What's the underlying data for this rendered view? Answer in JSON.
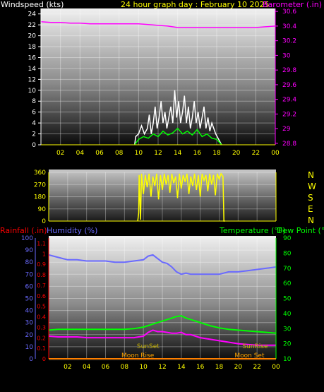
{
  "header": {
    "left_label": "Windspeed (kts)",
    "center_label": "24 hour graph day : February 10 2025",
    "right_label": "Barometer (.in)"
  },
  "colors": {
    "white": "#ffffff",
    "yellow": "#ffff00",
    "magenta": "#ff00ff",
    "green": "#00ff00",
    "red": "#ff0000",
    "blue": "#6a6aff",
    "orange": "#ffa500",
    "ochre": "#c8b400"
  },
  "chart_data": [
    {
      "type": "line",
      "panel": "wind-barometer",
      "x_ticks": [
        "02",
        "04",
        "06",
        "08",
        "10",
        "12",
        "14",
        "16",
        "18",
        "20",
        "22",
        "00"
      ],
      "left_axis": {
        "label": "Windspeed (kts)",
        "ticks": [
          "0",
          "2",
          "4",
          "6",
          "8",
          "10",
          "12",
          "14",
          "16",
          "18",
          "20",
          "22",
          "24"
        ],
        "ylim": [
          0,
          25
        ]
      },
      "right_axis": {
        "label": "Barometer (.in)",
        "ticks": [
          "28.8",
          "29",
          "29.2",
          "29.4",
          "29.6",
          "29.8",
          "30",
          "30.2",
          "30.4",
          "30.6"
        ],
        "ylim": [
          28.78,
          30.64
        ]
      },
      "series": [
        {
          "key": "barometer",
          "axis": "right",
          "points": [
            [
              0,
              30.46
            ],
            [
              1,
              30.45
            ],
            [
              2,
              30.45
            ],
            [
              3,
              30.44
            ],
            [
              4,
              30.44
            ],
            [
              5,
              30.43
            ],
            [
              6,
              30.43
            ],
            [
              7,
              30.43
            ],
            [
              8,
              30.43
            ],
            [
              9,
              30.43
            ],
            [
              10,
              30.43
            ],
            [
              11,
              30.42
            ],
            [
              12,
              30.41
            ],
            [
              13,
              30.4
            ],
            [
              14,
              30.38
            ],
            [
              15,
              30.38
            ],
            [
              16,
              30.38
            ],
            [
              17,
              30.38
            ],
            [
              18,
              30.38
            ],
            [
              19,
              30.38
            ],
            [
              20,
              30.38
            ],
            [
              21,
              30.38
            ],
            [
              22,
              30.38
            ],
            [
              23,
              30.39
            ],
            [
              24,
              30.4
            ]
          ]
        },
        {
          "key": "wind_gust",
          "axis": "left",
          "points": [
            [
              9.6,
              0
            ],
            [
              9.7,
              1.5
            ],
            [
              10,
              2
            ],
            [
              10.3,
              3.5
            ],
            [
              10.6,
              2
            ],
            [
              10.9,
              3
            ],
            [
              11.1,
              5.5
            ],
            [
              11.3,
              2
            ],
            [
              11.5,
              4
            ],
            [
              11.7,
              7
            ],
            [
              11.9,
              3
            ],
            [
              12.1,
              5
            ],
            [
              12.3,
              8
            ],
            [
              12.5,
              4
            ],
            [
              12.7,
              6
            ],
            [
              12.9,
              3
            ],
            [
              13.1,
              5
            ],
            [
              13.3,
              7
            ],
            [
              13.5,
              4
            ],
            [
              13.7,
              10
            ],
            [
              13.9,
              5
            ],
            [
              14.1,
              8
            ],
            [
              14.3,
              4
            ],
            [
              14.5,
              6
            ],
            [
              14.7,
              9
            ],
            [
              14.9,
              4
            ],
            [
              15.1,
              7
            ],
            [
              15.3,
              3
            ],
            [
              15.5,
              5
            ],
            [
              15.7,
              8
            ],
            [
              15.9,
              4
            ],
            [
              16.1,
              6
            ],
            [
              16.3,
              3
            ],
            [
              16.5,
              5
            ],
            [
              16.7,
              7
            ],
            [
              16.9,
              3
            ],
            [
              17.1,
              5
            ],
            [
              17.3,
              2.5
            ],
            [
              17.5,
              4
            ],
            [
              17.7,
              3
            ],
            [
              17.9,
              2
            ],
            [
              18.2,
              1
            ],
            [
              18.5,
              0
            ]
          ]
        },
        {
          "key": "wind_avg",
          "axis": "left",
          "points": [
            [
              9.6,
              0
            ],
            [
              10,
              1
            ],
            [
              10.5,
              1.5
            ],
            [
              11,
              1.2
            ],
            [
              11.5,
              2
            ],
            [
              12,
              1.5
            ],
            [
              12.5,
              2.5
            ],
            [
              13,
              1.8
            ],
            [
              13.5,
              2.2
            ],
            [
              14,
              3
            ],
            [
              14.5,
              2
            ],
            [
              15,
              2.5
            ],
            [
              15.5,
              1.8
            ],
            [
              16,
              2.8
            ],
            [
              16.5,
              1.5
            ],
            [
              17,
              2
            ],
            [
              17.5,
              1.2
            ],
            [
              18,
              1
            ],
            [
              18.5,
              0
            ]
          ]
        }
      ]
    },
    {
      "type": "line",
      "panel": "wind-direction",
      "y_ticks": [
        "0",
        "90",
        "180",
        "270",
        "360"
      ],
      "compass_labels": [
        "N",
        "W",
        "S",
        "E",
        "N"
      ],
      "ylim": [
        0,
        360
      ],
      "series": [
        {
          "key": "wind_direction",
          "points": [
            [
              9.4,
              0
            ],
            [
              9.5,
              60
            ],
            [
              9.55,
              340
            ],
            [
              9.7,
              10
            ],
            [
              9.8,
              350
            ],
            [
              10,
              200
            ],
            [
              10.2,
              340
            ],
            [
              10.4,
              250
            ],
            [
              10.6,
              350
            ],
            [
              10.8,
              180
            ],
            [
              11,
              330
            ],
            [
              11.2,
              260
            ],
            [
              11.4,
              350
            ],
            [
              11.6,
              160
            ],
            [
              11.8,
              340
            ],
            [
              12,
              230
            ],
            [
              12.2,
              350
            ],
            [
              12.4,
              270
            ],
            [
              12.6,
              340
            ],
            [
              12.8,
              210
            ],
            [
              13,
              350
            ],
            [
              13.2,
              280
            ],
            [
              13.4,
              330
            ],
            [
              13.6,
              170
            ],
            [
              13.8,
              350
            ],
            [
              14,
              240
            ],
            [
              14.2,
              340
            ],
            [
              14.4,
              290
            ],
            [
              14.6,
              350
            ],
            [
              14.8,
              200
            ],
            [
              15,
              330
            ],
            [
              15.2,
              260
            ],
            [
              15.4,
              350
            ],
            [
              15.6,
              230
            ],
            [
              15.8,
              340
            ],
            [
              16,
              180
            ],
            [
              16.2,
              350
            ],
            [
              16.4,
              300
            ],
            [
              16.6,
              340
            ],
            [
              16.8,
              220
            ],
            [
              17,
              350
            ],
            [
              17.2,
              270
            ],
            [
              17.4,
              340
            ],
            [
              17.6,
              190
            ],
            [
              17.8,
              350
            ],
            [
              18,
              310
            ],
            [
              18.2,
              350
            ],
            [
              18.4,
              330
            ],
            [
              18.5,
              0
            ],
            [
              18.6,
              0
            ]
          ]
        }
      ]
    },
    {
      "type": "line",
      "panel": "rain-humidity-temperature",
      "x_ticks": [
        "02",
        "04",
        "06",
        "08",
        "10",
        "12",
        "14",
        "16",
        "18",
        "20",
        "22",
        "00"
      ],
      "left_axis_rain": {
        "label": "Rainfall (.in)",
        "ticks": [
          "0",
          "0.1",
          "0.2",
          "0.3",
          "0.4",
          "0.5",
          "0.6",
          "0.7",
          "0.8",
          "0.9",
          "1",
          "1.1"
        ],
        "ylim": [
          0,
          1.15
        ]
      },
      "left_axis_humidity": {
        "label": "Humidity (%)",
        "ticks": [
          "0",
          "10",
          "20",
          "30",
          "40",
          "50",
          "60",
          "70",
          "80",
          "90",
          "100"
        ],
        "ylim": [
          0,
          100
        ]
      },
      "right_axis": {
        "label": "Temperature (°F)",
        "label2": "Dew Point (°F)",
        "ticks": [
          "10",
          "20",
          "30",
          "40",
          "50",
          "60",
          "70",
          "80",
          "90"
        ],
        "ylim": [
          10,
          90
        ]
      },
      "annotations": [
        {
          "text": "SunSet",
          "x": 10.5,
          "y_temp": 17,
          "color": "ochre"
        },
        {
          "text": "SunRise",
          "x": 21.8,
          "y_temp": 17,
          "color": "ochre"
        },
        {
          "text": "Moon Rise",
          "x": 9.4,
          "y_temp": 11,
          "color": "orange"
        },
        {
          "text": "Moon Set",
          "x": 21.2,
          "y_temp": 11,
          "color": "orange"
        }
      ],
      "series": [
        {
          "key": "humidity",
          "axis": "humidity",
          "points": [
            [
              0,
              86
            ],
            [
              0.5,
              85
            ],
            [
              1,
              84
            ],
            [
              1.5,
              83
            ],
            [
              2,
              82
            ],
            [
              3,
              82
            ],
            [
              4,
              81
            ],
            [
              5,
              81
            ],
            [
              6,
              81
            ],
            [
              7,
              80
            ],
            [
              8,
              80
            ],
            [
              9,
              81
            ],
            [
              10,
              82
            ],
            [
              10.5,
              85
            ],
            [
              11,
              86
            ],
            [
              11.5,
              83
            ],
            [
              12,
              80
            ],
            [
              12.5,
              79
            ],
            [
              13,
              76
            ],
            [
              13.5,
              72
            ],
            [
              14,
              70
            ],
            [
              14.5,
              71
            ],
            [
              15,
              70
            ],
            [
              16,
              70
            ],
            [
              17,
              70
            ],
            [
              18,
              70
            ],
            [
              19,
              72
            ],
            [
              20,
              72
            ],
            [
              21,
              73
            ],
            [
              22,
              74
            ],
            [
              23,
              75
            ],
            [
              24,
              76
            ]
          ]
        },
        {
          "key": "temperature",
          "axis": "right",
          "points": [
            [
              0,
              29
            ],
            [
              1,
              29.5
            ],
            [
              2,
              29.5
            ],
            [
              3,
              29.5
            ],
            [
              4,
              29.5
            ],
            [
              5,
              29.5
            ],
            [
              6,
              29.5
            ],
            [
              7,
              29.5
            ],
            [
              8,
              29.5
            ],
            [
              9,
              30
            ],
            [
              10,
              31
            ],
            [
              11,
              33
            ],
            [
              12,
              35
            ],
            [
              13,
              37
            ],
            [
              13.5,
              38
            ],
            [
              14,
              38.5
            ],
            [
              14.5,
              37
            ],
            [
              15,
              36
            ],
            [
              16,
              34
            ],
            [
              17,
              32
            ],
            [
              18,
              30.5
            ],
            [
              19,
              29.5
            ],
            [
              20,
              29
            ],
            [
              21,
              28.5
            ],
            [
              22,
              28
            ],
            [
              23,
              27.5
            ],
            [
              24,
              27
            ]
          ]
        },
        {
          "key": "dew_point",
          "axis": "right",
          "points": [
            [
              0,
              25
            ],
            [
              1,
              24.5
            ],
            [
              2,
              24.5
            ],
            [
              3,
              24.5
            ],
            [
              4,
              24
            ],
            [
              5,
              24
            ],
            [
              6,
              24
            ],
            [
              7,
              24
            ],
            [
              8,
              24
            ],
            [
              9,
              24
            ],
            [
              10,
              25
            ],
            [
              10.5,
              27.5
            ],
            [
              11,
              29
            ],
            [
              11.5,
              28
            ],
            [
              12,
              28
            ],
            [
              13,
              27
            ],
            [
              13.5,
              27
            ],
            [
              14,
              27.5
            ],
            [
              14.5,
              26
            ],
            [
              15,
              26
            ],
            [
              16,
              24
            ],
            [
              17,
              23
            ],
            [
              18,
              22
            ],
            [
              19,
              21
            ],
            [
              20,
              20
            ],
            [
              21,
              19.5
            ],
            [
              22,
              19
            ],
            [
              23,
              19
            ],
            [
              24,
              19
            ]
          ]
        },
        {
          "key": "rainfall",
          "axis": "rain",
          "points": [
            [
              0,
              0
            ],
            [
              24,
              0
            ]
          ]
        }
      ]
    }
  ]
}
